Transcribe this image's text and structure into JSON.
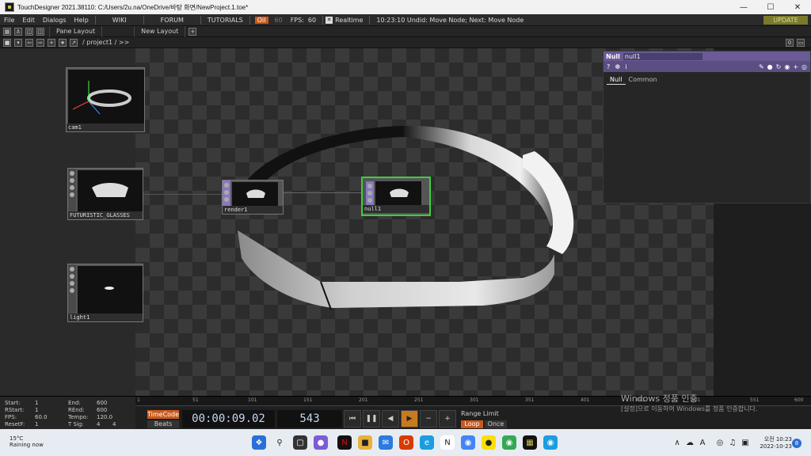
{
  "window": {
    "title": "TouchDesigner 2021.38110: C:/Users/2u.na/OneDrive/바탕 화면/NewProject.1.toe*"
  },
  "menu": {
    "file": "File",
    "edit": "Edit",
    "dialogs": "Dialogs",
    "help": "Help",
    "wiki": "WIKI",
    "forum": "FORUM",
    "tutorials": "TUTORIALS",
    "oil_badge": "Oil",
    "oil_value": "60",
    "fps_label": "FPS:",
    "fps_value": "60",
    "realtime": "Realtime",
    "status": "10:23:10 Undid: Move Node; Next: Move Node",
    "update": "UPDATE"
  },
  "layout": {
    "pane_layout": "Pane Layout",
    "new_layout": "New Layout",
    "add": "+"
  },
  "path": {
    "crumb": "/ project1 / >>",
    "num": "0"
  },
  "nodes": {
    "cam": "cam1",
    "geo": "FUTURISTIC_GLASSES",
    "light": "light1",
    "render": "render1",
    "null": "null1"
  },
  "params": {
    "type": "Null",
    "name": "null1",
    "tabs": [
      "Null",
      "Common"
    ]
  },
  "stats": {
    "start_label": "Start:",
    "start": "1",
    "end_label": "End:",
    "end": "600",
    "rstart_label": "RStart:",
    "rstart": "1",
    "rend_label": "REnd:",
    "rend": "600",
    "fps_label": "FPS:",
    "fps": "60.0",
    "tempo_label": "Tempo:",
    "tempo": "120.0",
    "resetf_label": "ResetF:",
    "resetf": "1",
    "tsig_label": "T Sig:",
    "tsig_a": "4",
    "tsig_b": "4"
  },
  "ruler": [
    "1",
    "51",
    "101",
    "151",
    "201",
    "251",
    "301",
    "351",
    "401",
    "451",
    "501",
    "551",
    "600"
  ],
  "timeline": {
    "timecode_btn": "TimeCode",
    "beats_btn": "Beats",
    "timecode": "00:00:09.02",
    "frame": "543",
    "range_limit": "Range Limit",
    "loop": "Loop",
    "once": "Once"
  },
  "watermark": {
    "line1": "Windows 정품 인증",
    "line2": "[설정]으로 이동하여 Windows를 정품 인증합니다."
  },
  "taskbar": {
    "temp": "15°C",
    "weather": "Raining now",
    "time": "오전 10:23",
    "date": "2022-10-23",
    "ime": "A",
    "notif": "8"
  }
}
